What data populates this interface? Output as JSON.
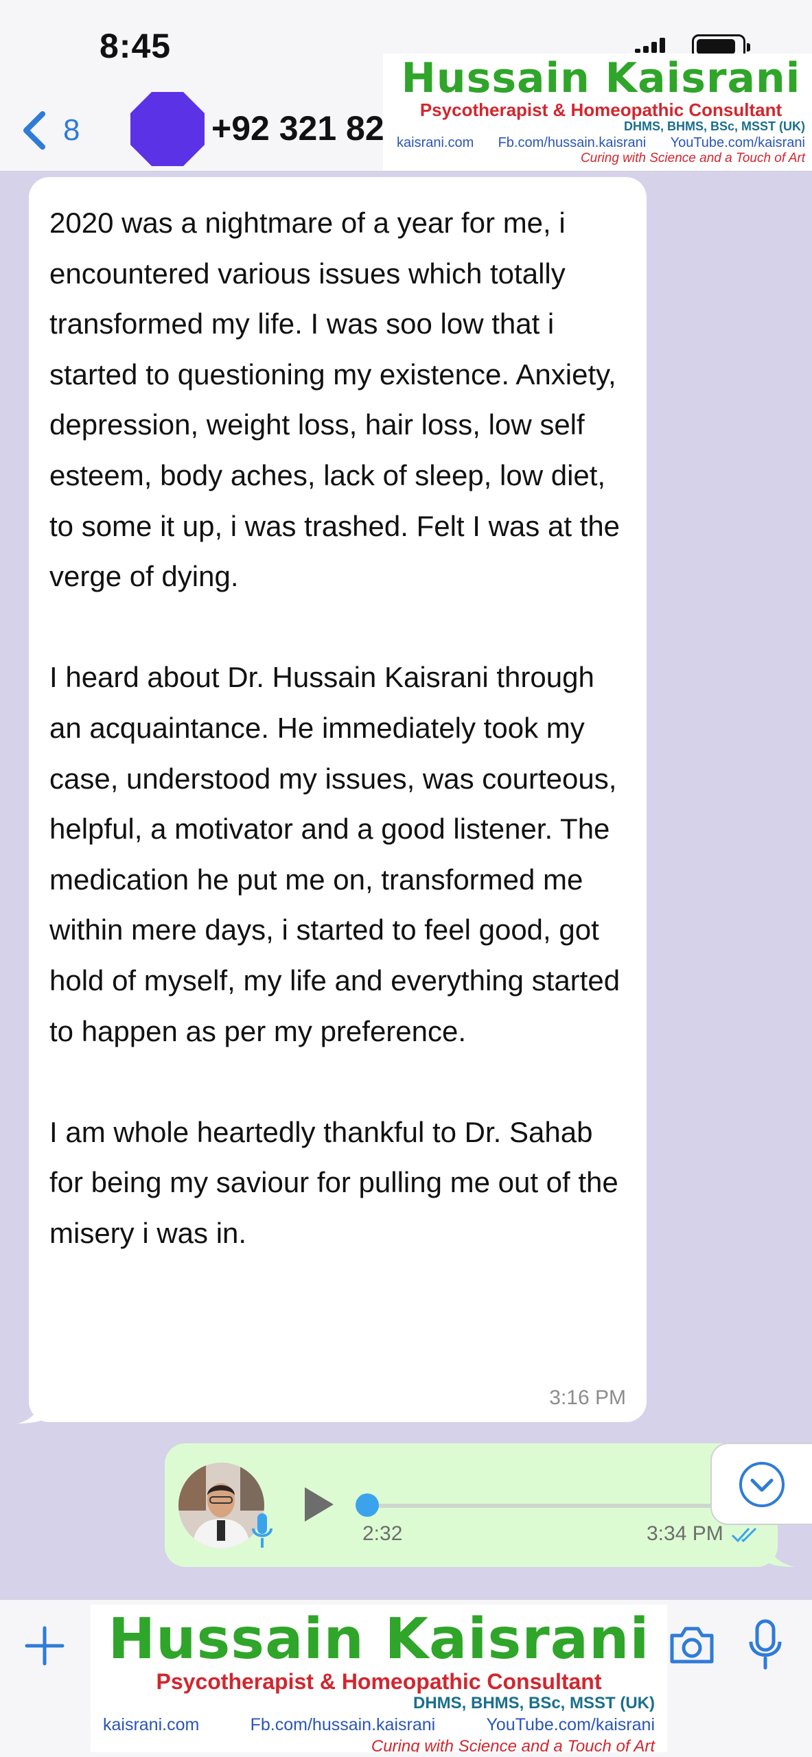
{
  "status_bar": {
    "time": "8:45"
  },
  "header": {
    "back_count": "8",
    "contact_name": "+92 321 82",
    "avatar_color": "#5b32e6",
    "accent_color": "#2f7bd8"
  },
  "watermark": {
    "title": "Hussain Kaisrani",
    "subtitle": "Psycotherapist & Homeopathic Consultant",
    "credentials": "DHMS, BHMS, BSc, MSST (UK)",
    "website": "kaisrani.com",
    "facebook": "Fb.com/hussain.kaisrani",
    "youtube": "YouTube.com/kaisrani",
    "tagline": "Curing with Science and a Touch of Art"
  },
  "messages": {
    "incoming": {
      "paragraphs": [
        "2020 was a nightmare of a year for me, i encountered various issues which totally transformed my life. I was soo low that i started to questioning my existence. Anxiety, depression, weight loss, hair loss, low self esteem, body aches, lack of sleep, low diet, to some it up, i was trashed. Felt I was at the verge of dying.",
        "I heard about Dr. Hussain Kaisrani through an acquaintance. He immediately took my case, understood my issues, was courteous, helpful, a motivator and a good listener. The medication he put me on, transformed me within mere days, i started to feel good, got hold of myself, my life and everything started to happen as per my preference.",
        "I am whole heartedly thankful to Dr. Sahab for being my saviour for pulling me out of the misery i was in."
      ],
      "time": "3:16 PM"
    },
    "outgoing_voice": {
      "duration": "2:32",
      "time": "3:34 PM",
      "progress": 0,
      "status_icon": "double-check-read-icon"
    }
  },
  "colors": {
    "chat_background": "#d6d2ea",
    "incoming_bubble": "#ffffff",
    "outgoing_bubble": "#ddfbd3",
    "read_ticks": "#3aa3ec",
    "watermark_green": "#2fa52a",
    "watermark_red": "#d2262e"
  }
}
